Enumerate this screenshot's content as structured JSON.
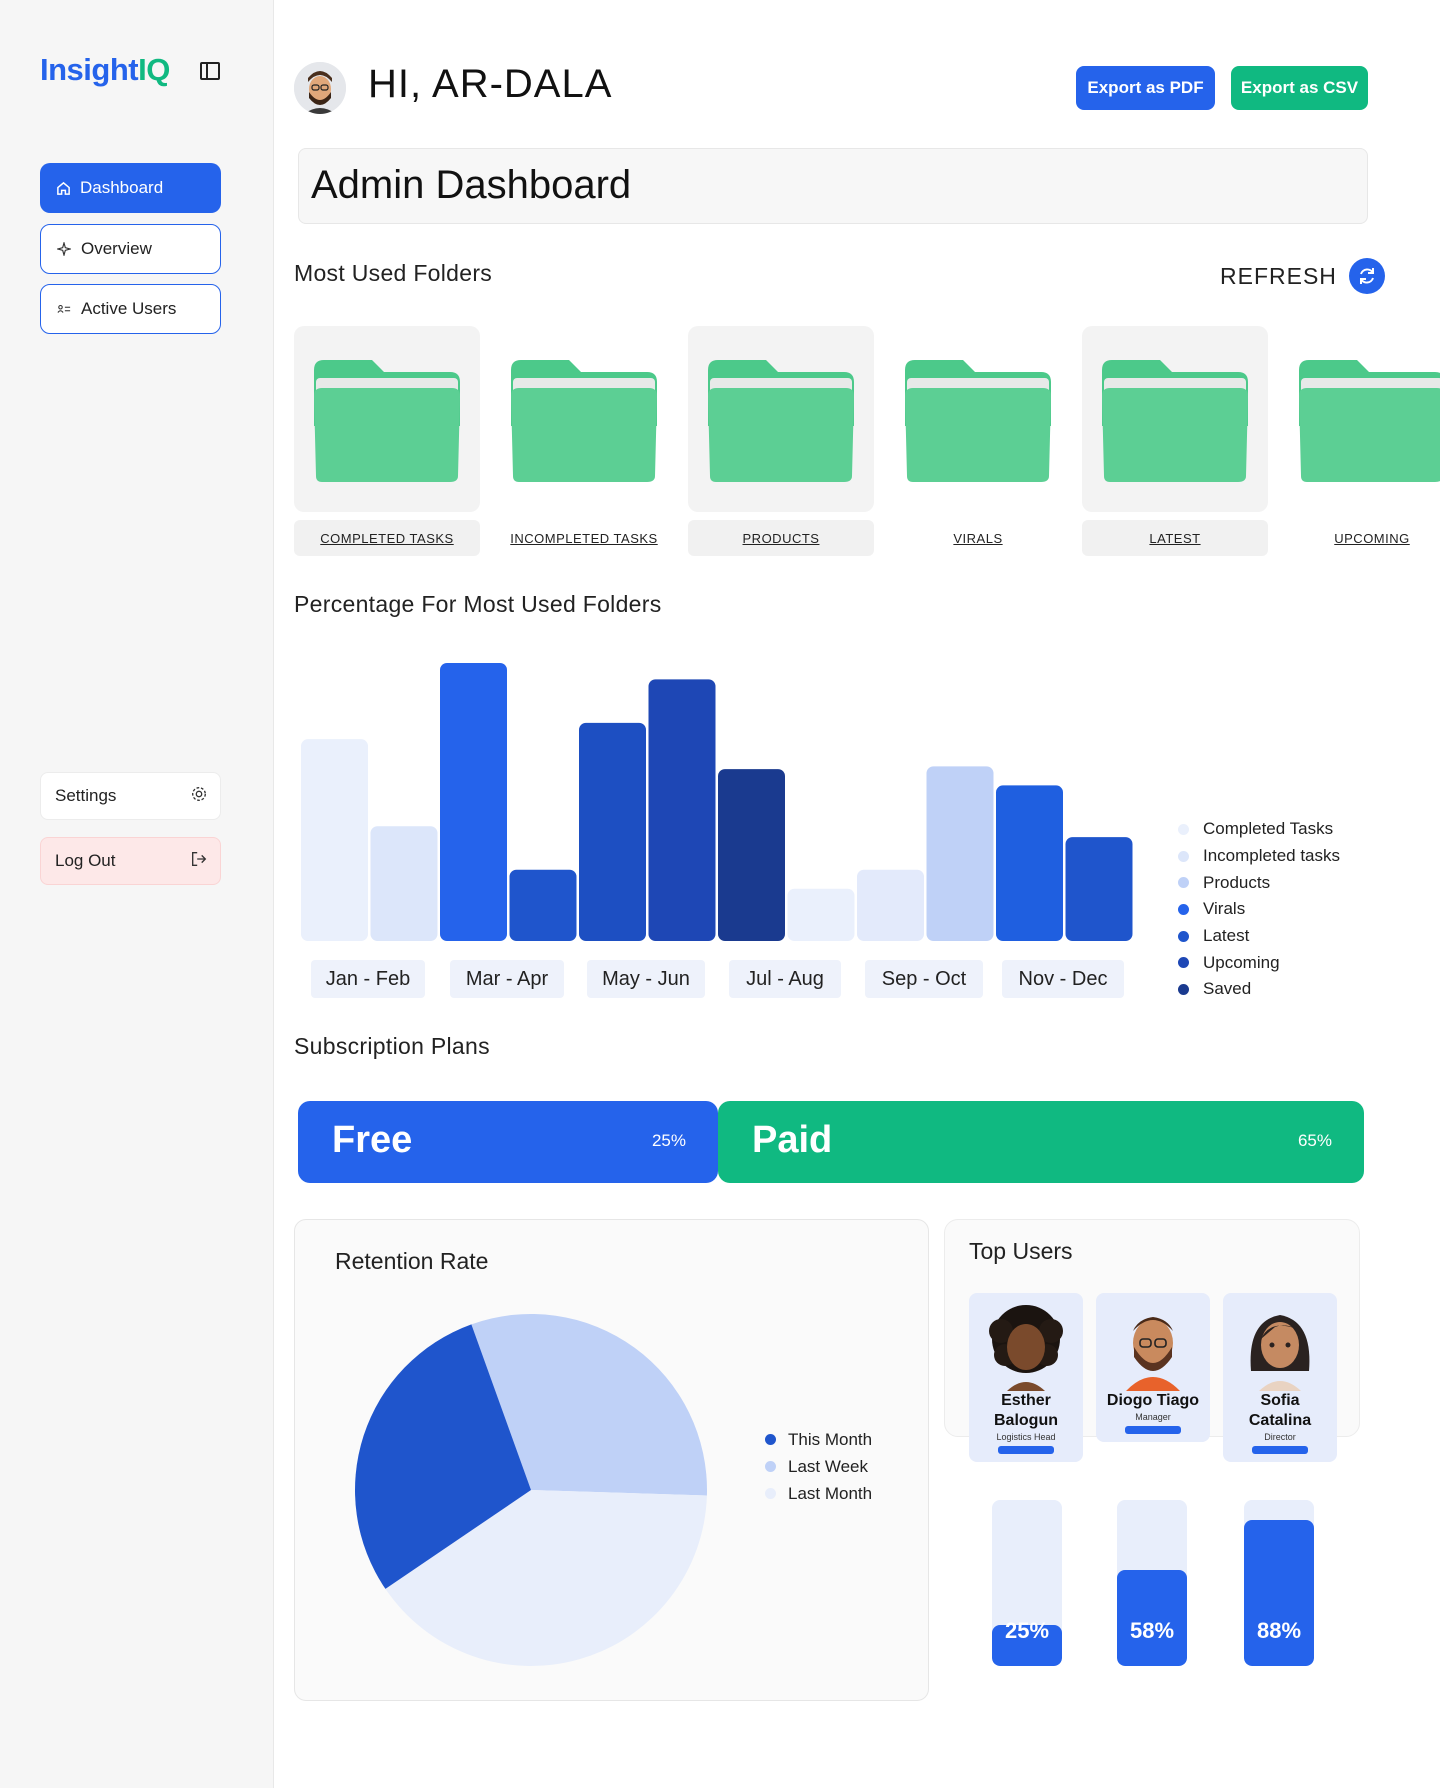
{
  "app": {
    "logo_main": "Insight",
    "logo_accent": "IQ"
  },
  "sidebar": {
    "items": [
      {
        "label": "Dashboard",
        "icon": "home-icon"
      },
      {
        "label": "Overview",
        "icon": "sparkle-icon"
      },
      {
        "label": "Active Users",
        "icon": "users-icon"
      }
    ],
    "settings_label": "Settings",
    "logout_label": "Log Out"
  },
  "header": {
    "greeting": "HI, AR-DALA",
    "export_pdf": "Export as PDF",
    "export_csv": "Export as CSV",
    "page_title": "Admin Dashboard"
  },
  "folders_section": {
    "title": "Most Used Folders",
    "refresh_label": "REFRESH",
    "folders": [
      {
        "label": "COMPLETED TASKS"
      },
      {
        "label": "INCOMPLETED TASKS"
      },
      {
        "label": "PRODUCTS"
      },
      {
        "label": "VIRALS"
      },
      {
        "label": "LATEST"
      },
      {
        "label": "UPCOMING"
      }
    ]
  },
  "chart_section": {
    "title": "Percentage For Most Used Folders"
  },
  "chart_data": {
    "type": "bar",
    "categories": [
      "Jan - Feb",
      "Mar - Apr",
      "May - Jun",
      "Jul - Aug",
      "Sep - Oct",
      "Nov - Dec"
    ],
    "bars": [
      {
        "value": 72,
        "color": "#eaf0fc"
      },
      {
        "value": 40,
        "color": "#dce6fa"
      },
      {
        "value": 100,
        "color": "#2563eb"
      },
      {
        "value": 24,
        "color": "#1f55cc"
      },
      {
        "value": 78,
        "color": "#1d4fc2"
      },
      {
        "value": 94,
        "color": "#1e47b5"
      },
      {
        "value": 61,
        "color": "#1a3a8f"
      },
      {
        "value": 17,
        "color": "#eaf0fc"
      },
      {
        "value": 24,
        "color": "#e3eafb"
      },
      {
        "value": 62,
        "color": "#bfd1f7"
      },
      {
        "value": 55,
        "color": "#1f5fe0"
      },
      {
        "value": 36,
        "color": "#1f55cc"
      }
    ],
    "legend": [
      {
        "name": "Completed Tasks",
        "color": "#eaf0fc"
      },
      {
        "name": "Incompleted tasks",
        "color": "#dce6fa"
      },
      {
        "name": "Products",
        "color": "#bfd1f7"
      },
      {
        "name": "Virals",
        "color": "#2563eb"
      },
      {
        "name": "Latest",
        "color": "#1f55cc"
      },
      {
        "name": "Upcoming",
        "color": "#1e47b5"
      },
      {
        "name": "Saved",
        "color": "#1a3a8f"
      }
    ]
  },
  "subscription": {
    "title": "Subscription Plans",
    "free": {
      "label": "Free",
      "percent": "25%"
    },
    "paid": {
      "label": "Paid",
      "percent": "65%"
    }
  },
  "retention": {
    "title": "Retention Rate",
    "chart_data": {
      "type": "pie",
      "slices": [
        {
          "name": "This Month",
          "value": 29,
          "color": "#1f55cc"
        },
        {
          "name": "Last Week",
          "value": 31,
          "color": "#bfd1f7"
        },
        {
          "name": "Last Month",
          "value": 40,
          "color": "#e8eefb"
        }
      ]
    }
  },
  "top_users": {
    "title": "Top Users",
    "users": [
      {
        "name_line1": "Esther",
        "name_line2": "Balogun",
        "role": "Logistics Head",
        "progress": 25,
        "progress_label": "25%"
      },
      {
        "name_line1": "Diogo Tiago",
        "name_line2": "",
        "role": "Manager",
        "progress": 58,
        "progress_label": "58%"
      },
      {
        "name_line1": "Sofia",
        "name_line2": "Catalina",
        "role": "Director",
        "progress": 88,
        "progress_label": "88%"
      }
    ]
  },
  "colors": {
    "primary": "#2563eb",
    "success": "#10b981",
    "danger_bg": "#fde8e8"
  }
}
